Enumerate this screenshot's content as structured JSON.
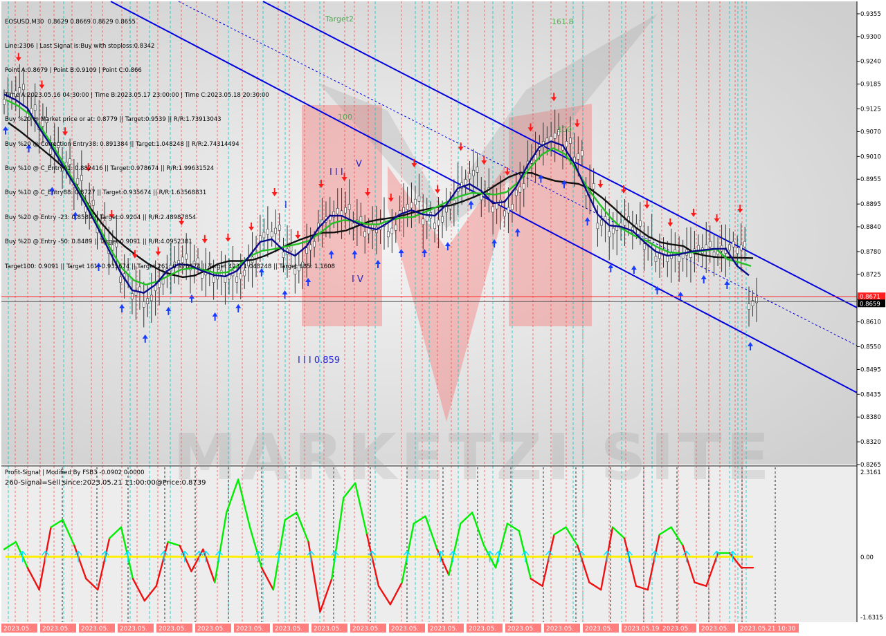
{
  "header": {
    "symbol_line": "EOSUSD,M30  0.8629 0.8669 0.8629 0.8655",
    "info_lines": [
      "Line:2306 | Last Signal is:Buy with stoploss:0.8342",
      "Point A:0.8679 | Point B:0.9109 | Point C:0.866",
      "Time A:2023.05.16 04:30:00 | Time B:2023.05.17 23:00:00 | Time C:2023.05.18 20:30:00",
      "Buy %20 @ Market price or at: 0.8779 || Target:0.9539 || R/R:1.73913043",
      "Buy %20 @ Correction Entry38: 0.891384 || Target:1.048248 || R/R:2.74314494",
      "Buy %10 @ C_Entry61: 0.882416 || Target:0.978674 || R/R:1.99631524",
      "Buy %10 @ C_Entry88: 0.8727 || Target:0.935674 || R/R:1.63568831",
      "Buy %20 @ Entry -23: 0.8589 || Target:0.9204 || R/R:2.48987854",
      "Buy %20 @ Entry -50: 0.8489 || Target:0.9091 || R/R:4.0952381",
      "Target100: 0.9091 || Target 161: 0.935674 || Target 261: 0.978674 || Target 423: 1.048248 || Target 685: 1.1608"
    ]
  },
  "watermark": "MARKETZI SITE",
  "annotations": {
    "target2": "Target2",
    "fib161": "161.8",
    "fib100a": "100",
    "fib100b": "100",
    "wave_i": "I",
    "wave_iii": "I I I",
    "wave_v": "V",
    "wave_iv": "I V",
    "wave_iii_price": "I I I 0.859"
  },
  "price_labels": {
    "current_red": "0.8671",
    "current_black": "0.8659"
  },
  "subwindow": {
    "title": "Profit-Signal | Modified By FSB3 -0.0902 0.0000",
    "signal": "260-Signal=Sell since:2023.05.21 11:00:00@Price:0.8739",
    "axis_top": "2.3161",
    "axis_zero": "0.00",
    "axis_bottom": "-1.6315"
  },
  "time_labels": [
    "2023.05.",
    "2023.05.",
    "2023.05.",
    "2023.05.",
    "2023.05.",
    "2023.05.",
    "2023.05.",
    "2023.05.",
    "2023.05.",
    "2023.05.",
    "2023.05.",
    "2023.05.",
    "2023.05.",
    "2023.05.",
    "2023.05.",
    "2023.05.",
    "2023.05.19 09:00",
    "2023.05.",
    "2023.05.",
    "2023.05.21 10:30"
  ],
  "colors": {
    "up_arrow": "#1a3cff",
    "down_arrow": "#ff1a1a",
    "ma_fast": "#0a0a8c",
    "ma_mid": "#22c022",
    "ma_slow": "#111111",
    "channel": "#0000e0",
    "osc_up": "#00ee00",
    "osc_down": "#ee1111",
    "osc_zero": "#ffee00",
    "vline_red": "#ff4040",
    "vline_cyan": "#00cccc",
    "time_label_bg": "#ff7070"
  },
  "chart_data": {
    "type": "line",
    "title": "EOSUSD,M30",
    "y_axis_ticks": [
      "0.9355",
      "0.9300",
      "0.9240",
      "0.9185",
      "0.9125",
      "0.9070",
      "0.9010",
      "0.8955",
      "0.8895",
      "0.8840",
      "0.8780",
      "0.8725",
      "0.8665",
      "0.8610",
      "0.8550",
      "0.8495",
      "0.8435",
      "0.8380",
      "0.8320",
      "0.8265"
    ],
    "ylim": [
      0.8265,
      0.9385
    ],
    "close_series": [
      0.915,
      0.917,
      0.912,
      0.909,
      0.903,
      0.899,
      0.895,
      0.889,
      0.884,
      0.879,
      0.872,
      0.868,
      0.866,
      0.87,
      0.874,
      0.876,
      0.875,
      0.873,
      0.872,
      0.872,
      0.872,
      0.876,
      0.882,
      0.883,
      0.878,
      0.874,
      0.879,
      0.885,
      0.887,
      0.888,
      0.885,
      0.883,
      0.884,
      0.883,
      0.888,
      0.89,
      0.886,
      0.885,
      0.889,
      0.894,
      0.897,
      0.892,
      0.889,
      0.888,
      0.893,
      0.9,
      0.904,
      0.906,
      0.904,
      0.901,
      0.893,
      0.885,
      0.883,
      0.885,
      0.884,
      0.88,
      0.877,
      0.877,
      0.877,
      0.878,
      0.879,
      0.878,
      0.879,
      0.879,
      0.8655
    ],
    "oscillator_series": [
      0.2,
      0.4,
      -0.3,
      -0.9,
      0.8,
      1.0,
      0.3,
      -0.6,
      -0.9,
      0.5,
      0.8,
      -0.6,
      -1.2,
      -0.8,
      0.4,
      0.3,
      -0.4,
      0.2,
      -0.7,
      1.2,
      2.1,
      0.8,
      -0.3,
      -0.9,
      1.0,
      1.2,
      0.4,
      -1.5,
      -0.6,
      1.6,
      2.0,
      0.6,
      -0.8,
      -1.3,
      -0.7,
      0.9,
      1.1,
      0.2,
      -0.5,
      0.9,
      1.2,
      0.3,
      -0.3,
      0.9,
      0.7,
      -0.6,
      -0.8,
      0.6,
      0.8,
      0.3,
      -0.7,
      -0.9,
      0.8,
      0.5,
      -0.8,
      -0.9,
      0.6,
      0.8,
      0.3,
      -0.7,
      -0.8,
      0.1,
      0.1,
      -0.3,
      -0.3
    ],
    "oscillator_ylim": [
      -1.6315,
      2.3161
    ]
  }
}
